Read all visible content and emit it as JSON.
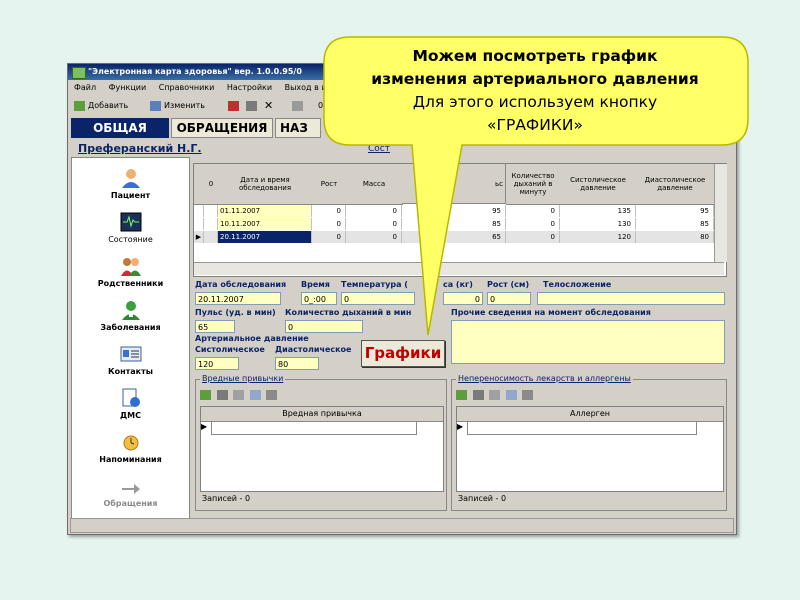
{
  "window": {
    "title": "\"Электронная карта здоровья\" вер. 1.0.0.95/0"
  },
  "menu": [
    "Файл",
    "Функции",
    "Справочники",
    "Настройки",
    "Выход в инт"
  ],
  "toolbar": {
    "add_label": "Добавить",
    "edit_label": "Изменить",
    "zero_label": "0"
  },
  "tabs": [
    "ОБЩАЯ",
    "ОБРАЩЕНИЯ",
    "НАЗ"
  ],
  "patient_name": "Преферанский Н.Г.",
  "patient_link_fragment": "Сост",
  "sidebar": [
    {
      "label": "Пациент",
      "icon": "person-icon"
    },
    {
      "label": "Состояние",
      "icon": "monitor-icon"
    },
    {
      "label": "Родственники",
      "icon": "family-icon"
    },
    {
      "label": "Заболевания",
      "icon": "doctor-icon"
    },
    {
      "label": "Контакты",
      "icon": "card-icon"
    },
    {
      "label": "ДМС",
      "icon": "document-icon"
    },
    {
      "label": "Напоминания",
      "icon": "alarm-icon"
    },
    {
      "label": "Обращения",
      "icon": "arrow-icon"
    }
  ],
  "grid": {
    "headers": [
      "0",
      "Дата и время обследования",
      "Рост",
      "Масса",
      "ьс",
      "Количество дыханий в минуту",
      "Систолическое давление",
      "Диастолическое давление"
    ],
    "rows": [
      [
        "01.11.2007",
        "0",
        "0",
        "95",
        "0",
        "135",
        "95"
      ],
      [
        "10.11.2007",
        "0",
        "0",
        "85",
        "0",
        "130",
        "85"
      ],
      [
        "20.11.2007",
        "0",
        "0",
        "65",
        "0",
        "120",
        "80"
      ]
    ]
  },
  "form": {
    "date_label": "Дата обследования",
    "date_value": "20.11.2007",
    "time_label": "Время",
    "time_value": "0_:00",
    "temp_label": "Температура (",
    "temp_value": "0",
    "mass_label": "са (кг)",
    "mass_value": "0",
    "height_label": "Рост (см)",
    "height_value": "0",
    "build_label": "Телосложение",
    "pulse_label": "Пульс (уд. в мин)",
    "pulse_value": "65",
    "breath_label": "Количество дыханий в мин",
    "breath_value": "0",
    "other_label": "Прочие сведения на момент обследования",
    "bp_label": "Артериальное давление",
    "sys_label": "Систолическое",
    "dia_label": "Диастолическое",
    "sys_value": "120",
    "dia_value": "80"
  },
  "habits": {
    "title": "Вредные привычки",
    "column": "Вредная привычка",
    "status": "Записей - 0"
  },
  "allergy": {
    "title": "Непереносимость лекарств и аллергены",
    "column": "Аллерген",
    "status": "Записей - 0"
  },
  "callout": {
    "line1": "Можем посмотреть график",
    "line2": "изменения артериального давления",
    "line3": "Для этого используем кнопку",
    "line4": "«ГРАФИКИ»"
  },
  "graphs_button": "Графики",
  "colors": {
    "callout_fill": "#ffff66",
    "accent": "#0a246a",
    "field": "#ffffc0",
    "button_text": "#c00000"
  }
}
